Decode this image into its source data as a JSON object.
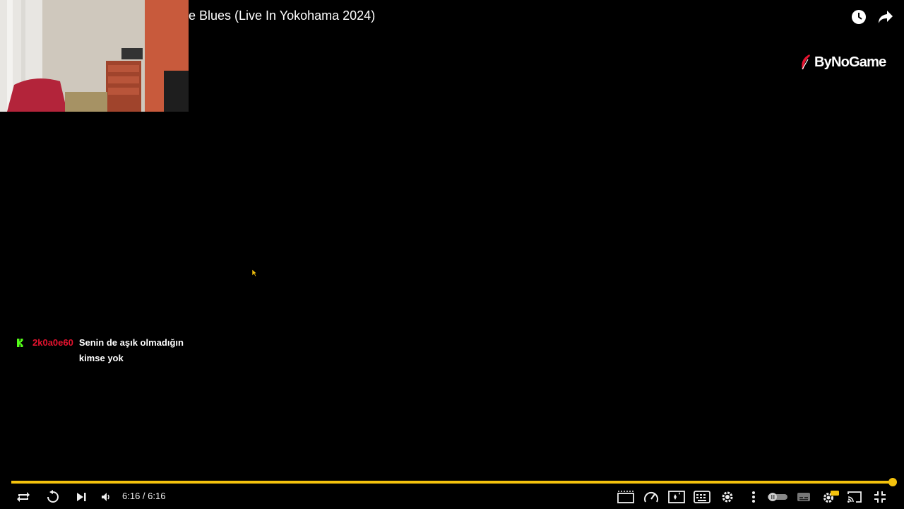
{
  "video": {
    "title": "e Blues (Live In Yokohama 2024)",
    "brand_name": "ByNoGame",
    "progress_fraction": 1.0,
    "accent_color": "#f4c20d"
  },
  "chat": {
    "username": "2k0a0e60",
    "username_color": "#e5132f",
    "message": "Senin de aşık olmadığın kimse yok"
  },
  "player": {
    "time_display": "6:16 / 6:16"
  },
  "icons": {
    "top": [
      "clock-icon",
      "share-icon"
    ],
    "left_controls": [
      "loop-icon",
      "replay-icon",
      "next-icon",
      "volume-icon"
    ],
    "right_controls": [
      "theater-icon",
      "speed-icon",
      "enhance-icon",
      "keyboard-icon",
      "settings-icon",
      "more-icon",
      "autoplay-toggle",
      "subtitles-icon",
      "quality-settings-icon",
      "cast-icon",
      "exit-fullscreen-icon"
    ]
  }
}
